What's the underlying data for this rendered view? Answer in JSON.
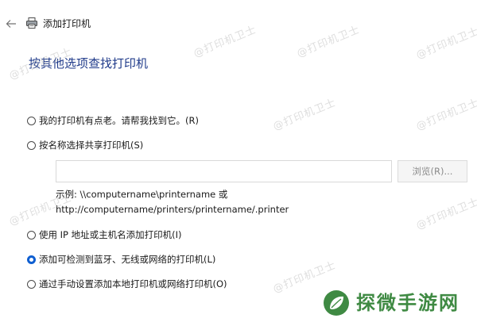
{
  "window": {
    "title": "添加打印机"
  },
  "page": {
    "heading": "按其他选项查找打印机"
  },
  "options": [
    {
      "label": "我的打印机有点老。请帮我找到它。(R)",
      "checked": false
    },
    {
      "label": "按名称选择共享打印机(S)",
      "checked": false
    },
    {
      "label": "使用 IP 地址或主机名添加打印机(I)",
      "checked": false
    },
    {
      "label": "添加可检测到蓝牙、无线或网络的打印机(L)",
      "checked": true
    },
    {
      "label": "通过手动设置添加本地打印机或网络打印机(O)",
      "checked": false
    }
  ],
  "share": {
    "input_value": "",
    "browse_label": "浏览(R)...",
    "example_line1": "示例: \\\\computername\\printername 或",
    "example_line2": "http://computername/printers/printername/.printer"
  },
  "watermark": {
    "text": "@打印机卫士"
  },
  "brand": {
    "text": "探微手游网"
  },
  "colors": {
    "heading": "#1f3a8a",
    "radio_checked": "#0f5fd1",
    "brand": "#3f8a43"
  }
}
